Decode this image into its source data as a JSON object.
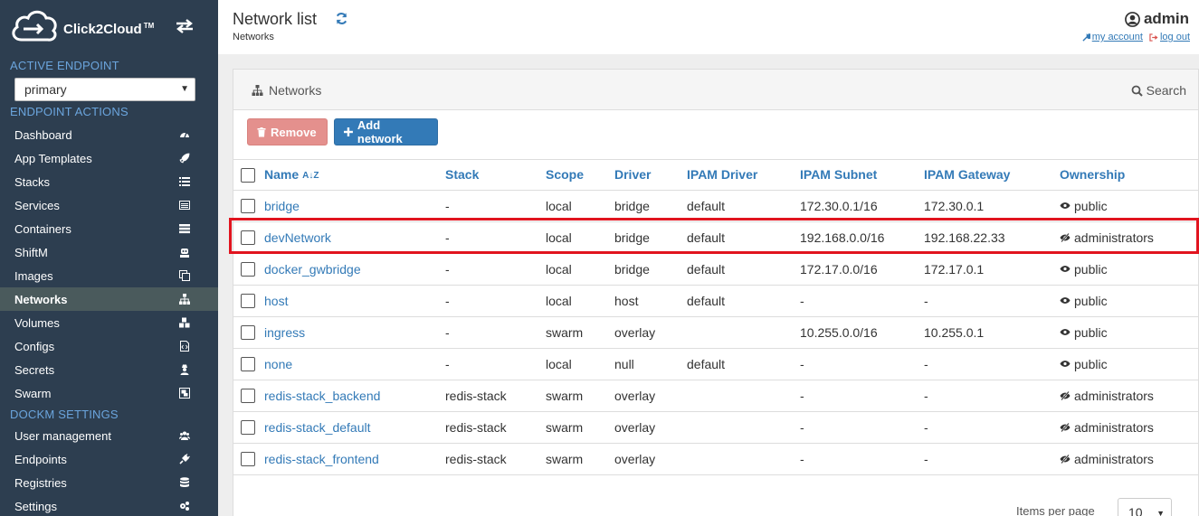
{
  "app": {
    "name": "Click2Cloud",
    "trademark": "TM"
  },
  "sidebar": {
    "active_endpoint_title": "ACTIVE ENDPOINT",
    "endpoint_value": "primary",
    "endpoint_actions_title": "ENDPOINT ACTIONS",
    "items": [
      {
        "label": "Dashboard",
        "icon": "dashboard-icon"
      },
      {
        "label": "App Templates",
        "icon": "rocket-icon"
      },
      {
        "label": "Stacks",
        "icon": "list-icon"
      },
      {
        "label": "Services",
        "icon": "list-alt-icon"
      },
      {
        "label": "Containers",
        "icon": "server-icon"
      },
      {
        "label": "ShiftM",
        "icon": "robot-icon"
      },
      {
        "label": "Images",
        "icon": "clone-icon"
      },
      {
        "label": "Networks",
        "icon": "sitemap-icon",
        "active": true
      },
      {
        "label": "Volumes",
        "icon": "cubes-icon"
      },
      {
        "label": "Configs",
        "icon": "file-code-icon"
      },
      {
        "label": "Secrets",
        "icon": "user-secret-icon"
      },
      {
        "label": "Swarm",
        "icon": "object-group-icon"
      }
    ],
    "settings_title": "DOCKM SETTINGS",
    "settings_items": [
      {
        "label": "User management",
        "icon": "users-icon"
      },
      {
        "label": "Endpoints",
        "icon": "plug-icon"
      },
      {
        "label": "Registries",
        "icon": "database-icon"
      },
      {
        "label": "Settings",
        "icon": "cogs-icon"
      }
    ]
  },
  "header": {
    "title": "Network list",
    "breadcrumb": "Networks",
    "user": "admin",
    "my_account": "my account",
    "log_out": "log out"
  },
  "panel": {
    "title": "Networks",
    "search": "Search",
    "remove_label": "Remove",
    "add_label": "Add network",
    "columns": [
      "Name",
      "Stack",
      "Scope",
      "Driver",
      "IPAM Driver",
      "IPAM Subnet",
      "IPAM Gateway",
      "Ownership"
    ],
    "sort_glyph": "A↓Z",
    "rows": [
      {
        "name": "bridge",
        "stack": "-",
        "scope": "local",
        "driver": "bridge",
        "ipam_driver": "default",
        "subnet": "172.30.0.1/16",
        "gateway": "172.30.0.1",
        "ownership": "public",
        "own_icon": "eye-icon"
      },
      {
        "name": "devNetwork",
        "stack": "-",
        "scope": "local",
        "driver": "bridge",
        "ipam_driver": "default",
        "subnet": "192.168.0.0/16",
        "gateway": "192.168.22.33",
        "ownership": "administrators",
        "own_icon": "eye-slash-icon"
      },
      {
        "name": "docker_gwbridge",
        "stack": "-",
        "scope": "local",
        "driver": "bridge",
        "ipam_driver": "default",
        "subnet": "172.17.0.0/16",
        "gateway": "172.17.0.1",
        "ownership": "public",
        "own_icon": "eye-icon"
      },
      {
        "name": "host",
        "stack": "-",
        "scope": "local",
        "driver": "host",
        "ipam_driver": "default",
        "subnet": "-",
        "gateway": "-",
        "ownership": "public",
        "own_icon": "eye-icon"
      },
      {
        "name": "ingress",
        "stack": "-",
        "scope": "swarm",
        "driver": "overlay",
        "ipam_driver": "",
        "subnet": "10.255.0.0/16",
        "gateway": "10.255.0.1",
        "ownership": "public",
        "own_icon": "eye-icon"
      },
      {
        "name": "none",
        "stack": "-",
        "scope": "local",
        "driver": "null",
        "ipam_driver": "default",
        "subnet": "-",
        "gateway": "-",
        "ownership": "public",
        "own_icon": "eye-icon"
      },
      {
        "name": "redis-stack_backend",
        "stack": "redis-stack",
        "scope": "swarm",
        "driver": "overlay",
        "ipam_driver": "",
        "subnet": "-",
        "gateway": "-",
        "ownership": "administrators",
        "own_icon": "eye-slash-icon"
      },
      {
        "name": "redis-stack_default",
        "stack": "redis-stack",
        "scope": "swarm",
        "driver": "overlay",
        "ipam_driver": "",
        "subnet": "-",
        "gateway": "-",
        "ownership": "administrators",
        "own_icon": "eye-slash-icon"
      },
      {
        "name": "redis-stack_frontend",
        "stack": "redis-stack",
        "scope": "swarm",
        "driver": "overlay",
        "ipam_driver": "",
        "subnet": "-",
        "gateway": "-",
        "ownership": "administrators",
        "own_icon": "eye-slash-icon"
      }
    ],
    "items_per_page_label": "Items per page",
    "items_per_page_value": "10"
  },
  "colors": {
    "sidebar_bg": "#2d3e50",
    "accent": "#337ab7",
    "highlight": "#e1141f",
    "remove_btn": "#e4908d"
  }
}
